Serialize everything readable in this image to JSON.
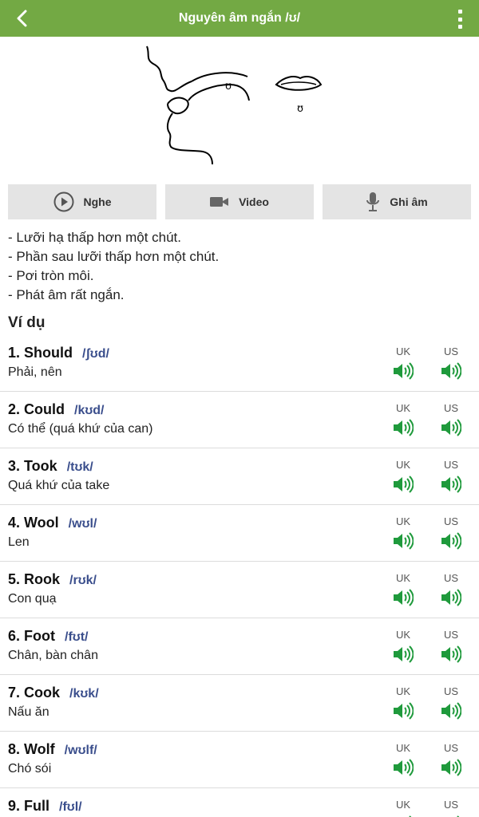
{
  "header": {
    "title": "Nguyên âm ngắn /ʊ/",
    "back_icon": "chevron-left-icon",
    "menu_icon": "more-vert-icon"
  },
  "diagram": {
    "tongue_symbol": "ʊ",
    "lips_symbol": "ʊ"
  },
  "actions": [
    {
      "label": "Nghe",
      "icon": "play-circle-icon"
    },
    {
      "label": "Video",
      "icon": "video-camera-icon"
    },
    {
      "label": "Ghi âm",
      "icon": "microphone-icon"
    }
  ],
  "description": [
    "- Lưỡi hạ thấp hơn một chút.",
    "- Phần sau lưỡi thấp hơn một chút.",
    "- Pơi tròn môi.",
    "- Phát âm rất ngắn."
  ],
  "examples_title": "Ví dụ",
  "audio_labels": {
    "uk": "UK",
    "us": "US"
  },
  "examples": [
    {
      "word": "1. Should",
      "ipa": "/ʃʊd/",
      "meaning": "Phải, nên"
    },
    {
      "word": "2. Could",
      "ipa": "/kʊd/",
      "meaning": "Có thể (quá khứ của can)"
    },
    {
      "word": "3. Took",
      "ipa": "/tʊk/",
      "meaning": "Quá khứ của take"
    },
    {
      "word": "4. Wool",
      "ipa": "/wʊl/",
      "meaning": "Len"
    },
    {
      "word": "5. Rook",
      "ipa": "/rʊk/",
      "meaning": "Con quạ"
    },
    {
      "word": "6. Foot",
      "ipa": "/fʊt/",
      "meaning": "Chân, bàn chân"
    },
    {
      "word": "7. Cook",
      "ipa": "/kʊk/",
      "meaning": "Nấu ăn"
    },
    {
      "word": "8. Wolf",
      "ipa": "/wʊlf/",
      "meaning": "Chó sói"
    },
    {
      "word": "9. Full",
      "ipa": "/fʊl/",
      "meaning": ""
    }
  ],
  "colors": {
    "header_bg": "#73a944",
    "speaker_green": "#1f9a3c",
    "ipa_blue": "#3a4e8c"
  }
}
